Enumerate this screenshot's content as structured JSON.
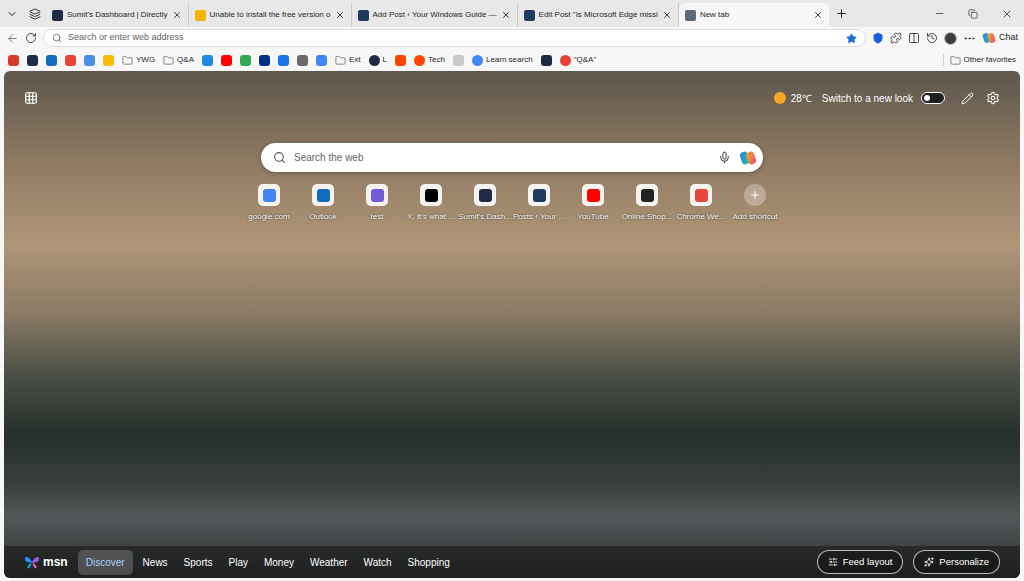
{
  "tabs": [
    {
      "label": "Sumit's Dashboard | Directly",
      "selected": false,
      "color": "#1f2a44"
    },
    {
      "label": "Unable to install the free version o",
      "selected": false,
      "color": "#f4b400"
    },
    {
      "label": "Add Post ‹ Your Windows Guide —",
      "selected": false,
      "color": "#1e3a5f"
    },
    {
      "label": "Edit Post \"Is Microsoft Edge missi",
      "selected": false,
      "color": "#1e3a5f"
    },
    {
      "label": "New tab",
      "selected": true,
      "color": "#5b6b7a"
    }
  ],
  "address_bar": {
    "placeholder": "Search or enter web address",
    "favorited": true
  },
  "toolbar": {
    "copilot_label": "Chat"
  },
  "bookmarks": [
    {
      "kind": "icon",
      "label": "",
      "color": "#d83b2b"
    },
    {
      "kind": "icon",
      "label": "",
      "color": "#1f2a44"
    },
    {
      "kind": "icon",
      "label": "",
      "color": "#0f6cbd"
    },
    {
      "kind": "icon",
      "label": "",
      "color": "#ea4335"
    },
    {
      "kind": "icon",
      "label": "",
      "color": "#4a90e2"
    },
    {
      "kind": "icon",
      "label": "",
      "color": "#fbbc04"
    },
    {
      "kind": "folder",
      "label": "YWG",
      "color": "#5f5f5f"
    },
    {
      "kind": "folder",
      "label": "Q&A",
      "color": "#5f5f5f"
    },
    {
      "kind": "icon",
      "label": "",
      "color": "#1e88e5"
    },
    {
      "kind": "icon",
      "label": "",
      "color": "#ff0000"
    },
    {
      "kind": "icon",
      "label": "",
      "color": "#34a853"
    },
    {
      "kind": "icon",
      "label": "",
      "color": "#003087"
    },
    {
      "kind": "icon",
      "label": "",
      "color": "#1a73e8"
    },
    {
      "kind": "icon",
      "label": "",
      "color": "#6b6b6b"
    },
    {
      "kind": "icon",
      "label": "",
      "color": "#4285f4"
    },
    {
      "kind": "folder",
      "label": "Ext",
      "color": "#5f5f5f"
    },
    {
      "kind": "link",
      "label": "L",
      "color": "#1f2a44"
    },
    {
      "kind": "icon",
      "label": "",
      "color": "#ff4500"
    },
    {
      "kind": "link",
      "label": "Tech",
      "color": "#ff4500"
    },
    {
      "kind": "icon",
      "label": "",
      "color": "#c9c9c9"
    },
    {
      "kind": "link",
      "label": "Learn search",
      "color": "#4285f4"
    },
    {
      "kind": "icon",
      "label": "",
      "color": "#1f2a44"
    },
    {
      "kind": "link",
      "label": "\"Q&A\"",
      "color": "#ea4335"
    }
  ],
  "other_favorites": "Other favorites",
  "weather": {
    "temperature": "28℃"
  },
  "new_look": {
    "label": "Switch to a new look",
    "on": false
  },
  "search": {
    "placeholder": "Search the web"
  },
  "shortcuts": [
    {
      "kind": "site",
      "label": "google.com",
      "color": "#4285f4"
    },
    {
      "kind": "site",
      "label": "Outlook",
      "color": "#0f6cbd"
    },
    {
      "kind": "site",
      "label": "test",
      "color": "#6d5cd6"
    },
    {
      "kind": "site",
      "label": "X. It's what ...",
      "color": "#000000"
    },
    {
      "kind": "site",
      "label": "Sumit's Dash...",
      "color": "#1f2a44"
    },
    {
      "kind": "site",
      "label": "Posts ‹ Your ...",
      "color": "#1e3a5f"
    },
    {
      "kind": "site",
      "label": "YouTube",
      "color": "#ff0000"
    },
    {
      "kind": "site",
      "label": "Online Shop...",
      "color": "#222222"
    },
    {
      "kind": "site",
      "label": "Chrome We...",
      "color": "#e8453c"
    },
    {
      "kind": "add",
      "label": "Add shortcut",
      "color": "#ffffff"
    }
  ],
  "feed": {
    "brand": "msn",
    "nav": [
      {
        "label": "Discover",
        "selected": true
      },
      {
        "label": "News",
        "selected": false
      },
      {
        "label": "Sports",
        "selected": false
      },
      {
        "label": "Play",
        "selected": false
      },
      {
        "label": "Money",
        "selected": false
      },
      {
        "label": "Weather",
        "selected": false
      },
      {
        "label": "Watch",
        "selected": false
      },
      {
        "label": "Shopping",
        "selected": false
      }
    ],
    "buttons": [
      "Feed layout",
      "Personalize"
    ]
  }
}
